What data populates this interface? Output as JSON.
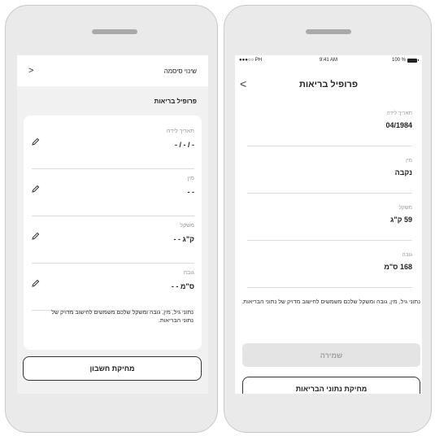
{
  "left_screen": {
    "change_password_label": "שינוי סיסמה",
    "section_title": "פרופיל בריאות",
    "fields": [
      {
        "label": "תאריך לידה",
        "value": "- / - / -"
      },
      {
        "label": "מין",
        "value": "- -"
      },
      {
        "label": "משקל",
        "value": "ק\"ג - -"
      },
      {
        "label": "גובה",
        "value": "ס\"מ - -"
      }
    ],
    "note": "נתוני גיל, מין, גובה ומשקל שלכם משמשים לחישוב מדויק של נתוני הבריאות.",
    "delete_account_label": "מחיקת חשבון"
  },
  "right_screen": {
    "status_bar": {
      "carrier": "●●●○○ PH",
      "time": "9:41 AM",
      "battery": "100 %"
    },
    "title": "פרופיל בריאות",
    "fields": [
      {
        "label": "תאריך לידה",
        "value": "04/1984"
      },
      {
        "label": "מין",
        "value": "נקבה"
      },
      {
        "label": "משקל",
        "value": "59 ק\"ג"
      },
      {
        "label": "גובה",
        "value": "168 ס\"מ"
      }
    ],
    "note": "נתוני גיל, מין, גובה ומשקל שלכם משמשים לחישוב מדויק של נתוני הבריאות.",
    "save_label": "שמירה",
    "delete_health_label": "מחיקת נתוני הבריאות"
  },
  "icons": {
    "chevron": "chevron-right-icon",
    "back": "chevron-left-icon",
    "edit": "pencil-icon"
  }
}
